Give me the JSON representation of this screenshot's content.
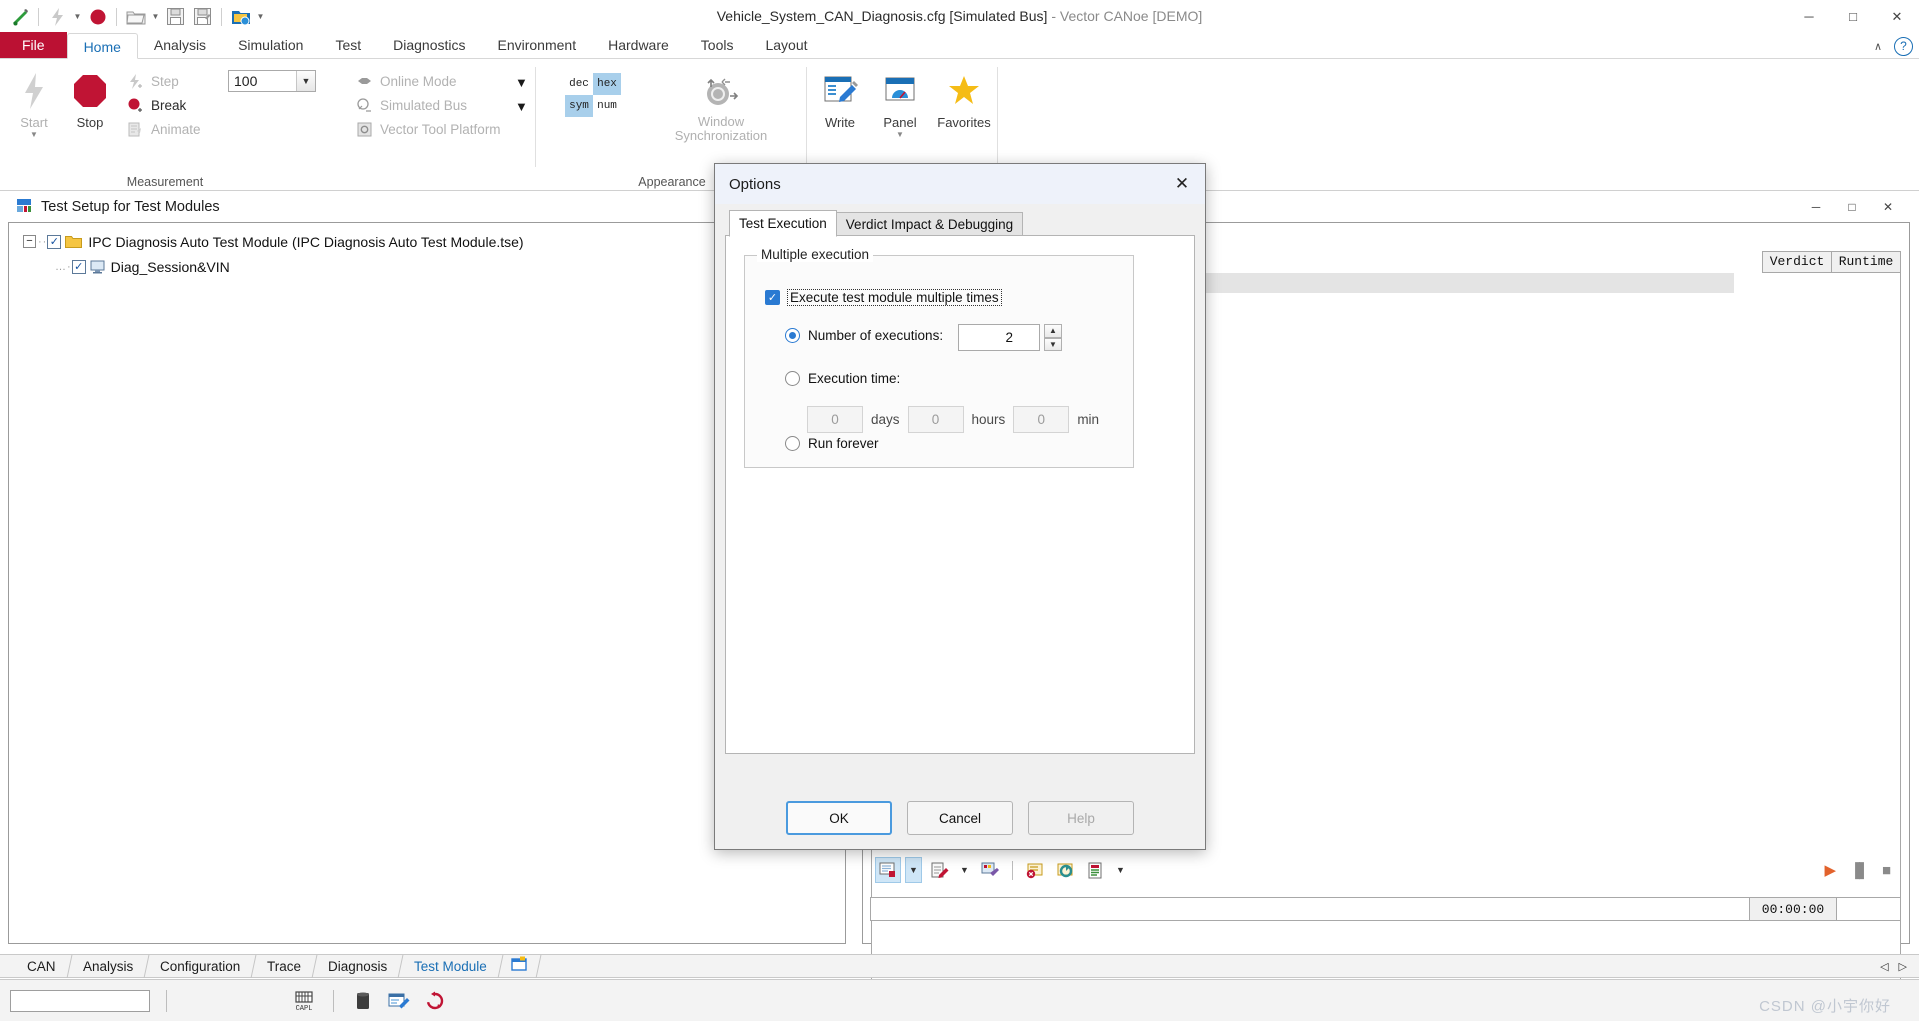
{
  "window": {
    "title_main": "Vehicle_System_CAN_Diagnosis.cfg [Simulated Bus]",
    "title_dim": " - Vector CANoe [DEMO]",
    "minimize": "─",
    "maximize": "□",
    "close": "✕"
  },
  "quick_access": {
    "items": [
      {
        "name": "canoe-logo-icon",
        "label": ""
      },
      {
        "name": "start-measurement-icon",
        "label": ""
      },
      {
        "name": "record-icon",
        "label": ""
      },
      {
        "name": "open-config-icon",
        "label": ""
      },
      {
        "name": "save-icon",
        "label": ""
      },
      {
        "name": "save-as-icon",
        "label": ""
      },
      {
        "name": "configuration-folder-icon",
        "label": ""
      },
      {
        "name": "customize-qat-icon",
        "label": ""
      }
    ]
  },
  "ribbon": {
    "tabs": [
      {
        "label": "File",
        "active": false,
        "file": true
      },
      {
        "label": "Home",
        "active": true
      },
      {
        "label": "Analysis",
        "active": false
      },
      {
        "label": "Simulation",
        "active": false
      },
      {
        "label": "Test",
        "active": false
      },
      {
        "label": "Diagnostics",
        "active": false
      },
      {
        "label": "Environment",
        "active": false
      },
      {
        "label": "Hardware",
        "active": false
      },
      {
        "label": "Tools",
        "active": false
      },
      {
        "label": "Layout",
        "active": false
      }
    ],
    "collapse_icon": "∧",
    "help_icon": "?",
    "groups": [
      {
        "label": "Measurement"
      },
      {
        "label": "Appearance"
      }
    ],
    "measurement": {
      "start_label": "Start",
      "stop_label": "Stop",
      "step_label": "Step",
      "break_label": "Break",
      "animate_label": "Animate",
      "speed_value": "100",
      "online_mode_label": "Online Mode",
      "simulated_bus_label": "Simulated Bus",
      "vector_tool_platform_label": "Vector Tool Platform"
    },
    "appearance": {
      "numbase": [
        "dec",
        "hex",
        "sym",
        "num"
      ],
      "numbase_selected": [
        "hex",
        "sym"
      ],
      "window_sync_line1": "Window",
      "window_sync_line2": "Synchronization"
    },
    "views": {
      "write_label": "Write",
      "panel_label": "Panel",
      "favorites_label": "Favorites"
    }
  },
  "test_setup_window": {
    "title": "Test Setup for Test Modules",
    "minimize": "─",
    "maximize": "□",
    "close": "✕",
    "tree": [
      {
        "label": "IPC Diagnosis Auto Test Module  (IPC Diagnosis Auto Test Module.tse)",
        "checked": true,
        "expanded": true,
        "icon": "folder-icon"
      },
      {
        "label": "Diag_Session&VIN",
        "checked": true,
        "icon": "test-module-icon"
      }
    ],
    "result_columns": [
      "Verdict",
      "Runtime"
    ],
    "toolbar": [
      {
        "name": "report-button",
        "selected": true
      },
      {
        "name": "report-dropdown-caret",
        "selected": true
      },
      {
        "name": "edit-test-button",
        "selected": false
      },
      {
        "name": "edit-test-caret",
        "selected": false
      },
      {
        "name": "test-configuration-button",
        "selected": false
      },
      {
        "name": "error-filter-button",
        "selected": false
      },
      {
        "name": "reload-test-button",
        "selected": false
      },
      {
        "name": "show-report-button",
        "selected": false
      },
      {
        "name": "show-report-caret",
        "selected": false
      }
    ],
    "transport": [
      {
        "name": "start-test-button",
        "glyph": "▶"
      },
      {
        "name": "pause-test-button",
        "glyph": "▐▌"
      },
      {
        "name": "stop-test-button",
        "glyph": "■"
      }
    ],
    "elapsed_time": "00:00:00"
  },
  "options_dialog": {
    "title": "Options",
    "close_icon": "✕",
    "tabs": [
      {
        "label": "Test Execution",
        "active": true
      },
      {
        "label": "Verdict Impact & Debugging",
        "active": false
      }
    ],
    "group_title": "Multiple execution",
    "checkbox": {
      "label": "Execute test module multiple times",
      "checked": true,
      "glyph": "✓"
    },
    "mode_number": {
      "label": "Number of executions:",
      "selected": true,
      "value": "2",
      "up_glyph": "▲",
      "down_glyph": "▼"
    },
    "mode_time": {
      "label": "Execution time:",
      "selected": false,
      "days_value": "0",
      "days_unit": "days",
      "hours_value": "0",
      "hours_unit": "hours",
      "minutes_value": "0",
      "minutes_unit": "min"
    },
    "mode_forever": {
      "label": "Run forever",
      "selected": false
    },
    "buttons": {
      "ok": "OK",
      "cancel": "Cancel",
      "help": "Help"
    }
  },
  "bottom_tabs": {
    "items": [
      {
        "label": "CAN",
        "active": false
      },
      {
        "label": "Analysis",
        "active": false
      },
      {
        "label": "Configuration",
        "active": false
      },
      {
        "label": "Trace",
        "active": false
      },
      {
        "label": "Diagnosis",
        "active": false
      },
      {
        "label": "Test Module",
        "active": true
      }
    ],
    "add_tab_icon": "new-tab-icon",
    "scroll_left": "◁",
    "scroll_right": "▷"
  },
  "status_bar": {
    "input_value": "",
    "input_placeholder": "",
    "icons": [
      {
        "name": "capl-browser-icon",
        "label": "CAPL"
      },
      {
        "name": "database-icon",
        "label": ""
      },
      {
        "name": "notes-icon",
        "label": ""
      },
      {
        "name": "reset-icon",
        "label": ""
      }
    ],
    "watermark": "CSDN @小宇你好"
  },
  "colors": {
    "accent_red": "#bb1133",
    "accent_blue": "#1a6fb5",
    "checkbox_blue": "#2a7ad2",
    "highlight": "#a8cfeb"
  }
}
